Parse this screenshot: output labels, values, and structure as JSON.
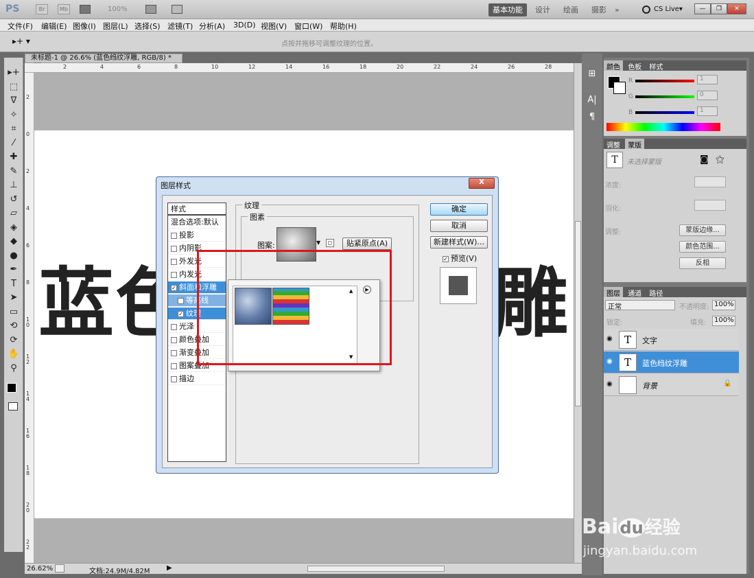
{
  "app": {
    "logo": "PS",
    "mini_buttons": [
      "Br",
      "Mb"
    ],
    "zoom": "100%",
    "workspaces": [
      "基本功能",
      "设计",
      "绘画",
      "摄影",
      "»"
    ],
    "cs_live": "CS Live▾"
  },
  "menu": [
    "文件(F)",
    "编辑(E)",
    "图像(I)",
    "图层(L)",
    "选择(S)",
    "滤镜(T)",
    "分析(A)",
    "3D(D)",
    "视图(V)",
    "窗口(W)",
    "帮助(H)"
  ],
  "options": {
    "hint": "点按并拖移可调整纹理的位置。"
  },
  "document": {
    "tab_title": "未标题-1 @ 26.6% (蓝色绉纹浮雕, RGB/8) *",
    "ruler_top": [
      "2",
      "4",
      "6",
      "8",
      "10",
      "12",
      "14",
      "16",
      "18",
      "20",
      "22",
      "24",
      "26",
      "28"
    ],
    "ruler_left": [
      "2",
      "0",
      "2",
      "4",
      "6",
      "8",
      "1\n0",
      "1\n2",
      "1\n4",
      "1\n6",
      "1\n8",
      "2\n0",
      "2\n2"
    ],
    "canvas_text_left": "蓝色",
    "canvas_text_right": "雕",
    "status_zoom": "26.62%",
    "status_doc": "文档:24.9M/4.82M"
  },
  "dialog": {
    "title": "图层样式",
    "close": "X",
    "styles": [
      {
        "label": "样式",
        "type": "header"
      },
      {
        "label": "混合选项:默认",
        "type": "plain"
      },
      {
        "label": "投影",
        "type": "cb",
        "checked": false
      },
      {
        "label": "内阴影",
        "type": "cb",
        "checked": false
      },
      {
        "label": "外发光",
        "type": "cb",
        "checked": false
      },
      {
        "label": "内发光",
        "type": "cb",
        "checked": false
      },
      {
        "label": "斜面和浮雕",
        "type": "cb",
        "checked": true,
        "state": "sel"
      },
      {
        "label": "等高线",
        "type": "cb",
        "checked": false,
        "state": "subsel"
      },
      {
        "label": "纹理",
        "type": "cb",
        "checked": true,
        "state": "sel"
      },
      {
        "label": "光泽",
        "type": "cb",
        "checked": false
      },
      {
        "label": "颜色叠加",
        "type": "cb",
        "checked": false
      },
      {
        "label": "渐变叠加",
        "type": "cb",
        "checked": false
      },
      {
        "label": "图案叠加",
        "type": "cb",
        "checked": false
      },
      {
        "label": "描边",
        "type": "cb",
        "checked": false
      }
    ],
    "group_texture": "纹理",
    "group_pattern": "图素",
    "pattern_label": "图案:",
    "snap_button": "贴紧原点(A)",
    "ok": "确定",
    "cancel": "取消",
    "new_style": "新建样式(W)...",
    "preview": "预览(V)",
    "preview_checked": true
  },
  "panels": {
    "color_tabs": [
      "颜色",
      "色板",
      "样式"
    ],
    "rgb": [
      {
        "ch": "R",
        "val": "1"
      },
      {
        "ch": "G",
        "val": "0"
      },
      {
        "ch": "B",
        "val": "1"
      }
    ],
    "adj_tabs": [
      "调整",
      "蒙版"
    ],
    "mask_text": "未选择蒙版",
    "density": "浓度:",
    "feather": "羽化:",
    "refine": "调整:",
    "mask_edge": "蒙版边缘...",
    "color_range": "颜色范围...",
    "invert": "反相",
    "layer_tabs": [
      "图层",
      "通道",
      "路径"
    ],
    "blend_mode": "正常",
    "opacity_label": "不透明度:",
    "opacity": "100%",
    "lock_label": "锁定:",
    "fill_label": "填充:",
    "fill": "100%",
    "layers": [
      {
        "name": "文字",
        "thumb": "T",
        "selected": false
      },
      {
        "name": "蓝色绉纹浮雕",
        "thumb": "T",
        "selected": true
      },
      {
        "name": "背景",
        "thumb": "",
        "selected": false,
        "locked": true
      }
    ]
  },
  "watermark": {
    "line1": "Bai",
    "line2": "du",
    "line3": "经验",
    "url": "jingyan.baidu.com"
  }
}
